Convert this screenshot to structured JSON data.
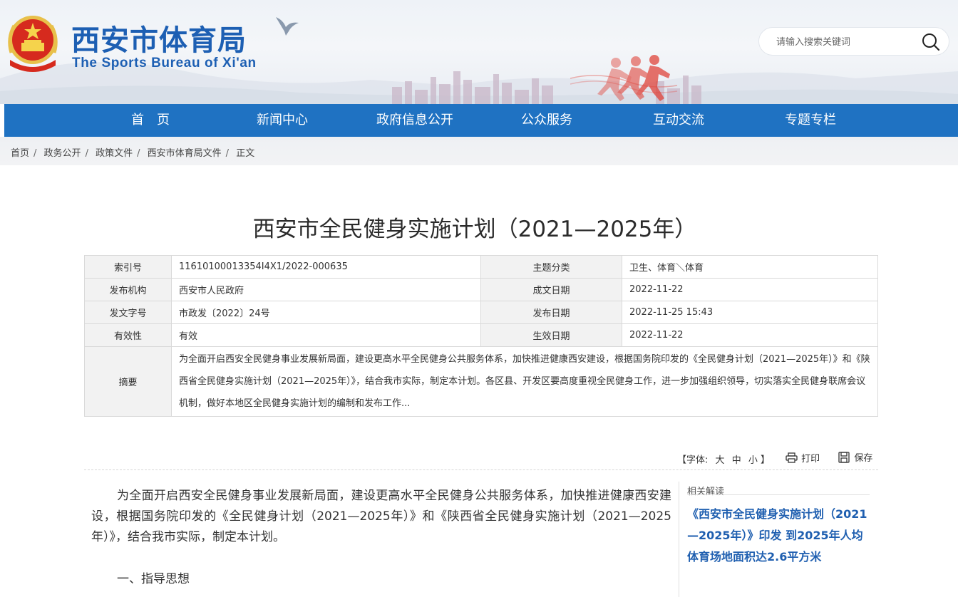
{
  "header": {
    "site_title_cn": "西安市体育局",
    "site_title_en": "The Sports Bureau of Xi'an",
    "brand_color": "#1d5fb3",
    "search_placeholder": "请输入搜索关键词"
  },
  "nav": {
    "bg_color": "#1f72c2",
    "items": [
      "首　页",
      "新闻中心",
      "政府信息公开",
      "公众服务",
      "互动交流",
      "专题专栏"
    ]
  },
  "breadcrumb": [
    "首页",
    "政务公开",
    "政策文件",
    "西安市体育局文件",
    "正文"
  ],
  "article": {
    "title": "西安市全民健身实施计划（2021—2025年）",
    "meta": {
      "index_label": "索引号",
      "index_value": "11610100013354I4X1/2022-000635",
      "topic_label": "主题分类",
      "topic_value": "卫生、体育＼体育",
      "issuer_label": "发布机构",
      "issuer_value": "西安市人民政府",
      "written_label": "成文日期",
      "written_value": "2022-11-22",
      "docno_label": "发文字号",
      "docno_value": "市政发〔2022〕24号",
      "published_label": "发布日期",
      "published_value": "2022-11-25 15:43",
      "validity_label": "有效性",
      "validity_value": "有效",
      "effective_label": "生效日期",
      "effective_value": "2022-11-22",
      "abstract_label": "摘要",
      "abstract_value": "为全面开启西安全民健身事业发展新局面，建设更高水平全民健身公共服务体系，加快推进健康西安建设，根据国务院印发的《全民健身计划（2021—2025年）》和《陕西省全民健身实施计划（2021—2025年）》，结合我市实际，制定本计划。各区县、开发区要高度重视全民健身工作，进一步加强组织领导，切实落实全民健身联席会议机制，做好本地区全民健身实施计划的编制和发布工作..."
    },
    "tools": {
      "font_label": "【字体:",
      "font_large": "大",
      "font_medium": "中",
      "font_small": "小",
      "font_end": "】",
      "print": "打印",
      "save": "保存"
    },
    "paragraph": "为全面开启西安全民健身事业发展新局面，建设更高水平全民健身公共服务体系，加快推进健康西安建设，根据国务院印发的《全民健身计划（2021—2025年）》和《陕西省全民健身实施计划（2021—2025年）》，结合我市实际，制定本计划。",
    "section_1": "一、指导思想"
  },
  "sidebar": {
    "title": "相关解读",
    "link": "《西安市全民健身实施计划（2021—2025年）》印发 到2025年人均体育场地面积达2.6平方米",
    "link_color": "#1f5fb0"
  }
}
